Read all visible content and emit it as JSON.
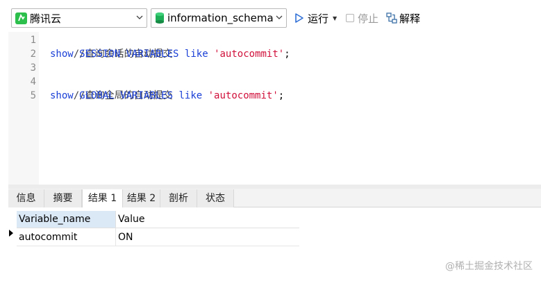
{
  "toolbar": {
    "connection": "腾讯云",
    "database": "information_schema",
    "run_label": "运行",
    "stop_label": "停止",
    "explain_label": "解释",
    "colors": {
      "connection_icon": "#2dbf4b",
      "db_icon": "#1fae58",
      "run_icon": "#2f6fd6"
    }
  },
  "editor": {
    "line_numbers": [
      "1",
      "2",
      "3",
      "4",
      "5"
    ],
    "lines": [
      {
        "comment": "//查询会话的自动提交"
      },
      {
        "kw1": "show",
        "kw2": "SESSION",
        "kw3": "VARIABLES",
        "kw4": "like",
        "str": "'autocommit'",
        "end": ";"
      },
      {},
      {
        "comment": "//查询全局的自动提交"
      },
      {
        "kw1": "show",
        "kw2": "GLOBAL",
        "kw3": "VARIABLES",
        "kw4": "like",
        "str": "'autocommit'",
        "end": ";"
      }
    ]
  },
  "tabs": [
    {
      "label": "信息",
      "active": false
    },
    {
      "label": "摘要",
      "active": false
    },
    {
      "label": "结果 1",
      "active": true
    },
    {
      "label": "结果 2",
      "active": false
    },
    {
      "label": "剖析",
      "active": false
    },
    {
      "label": "状态",
      "active": false
    }
  ],
  "result": {
    "columns": [
      "Variable_name",
      "Value"
    ],
    "rows": [
      [
        "autocommit",
        "ON"
      ]
    ]
  },
  "watermark": "@稀土掘金技术社区"
}
